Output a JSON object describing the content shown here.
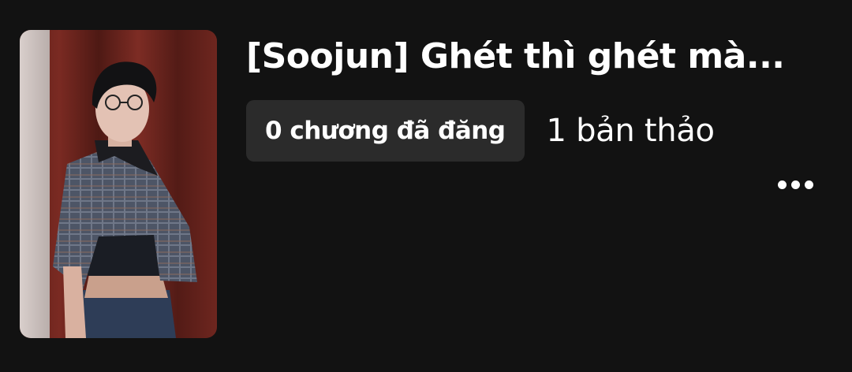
{
  "story": {
    "title": "[Soojun] Ghét thì ghét mà...",
    "published_badge": "0 chương đã đăng",
    "drafts": "1 bản thảo",
    "cover_alt": "Story cover photo",
    "more_icon": "more-horizontal-icon"
  },
  "colors": {
    "background": "#121212",
    "badge_bg": "#2b2b2b",
    "text": "#ffffff"
  }
}
